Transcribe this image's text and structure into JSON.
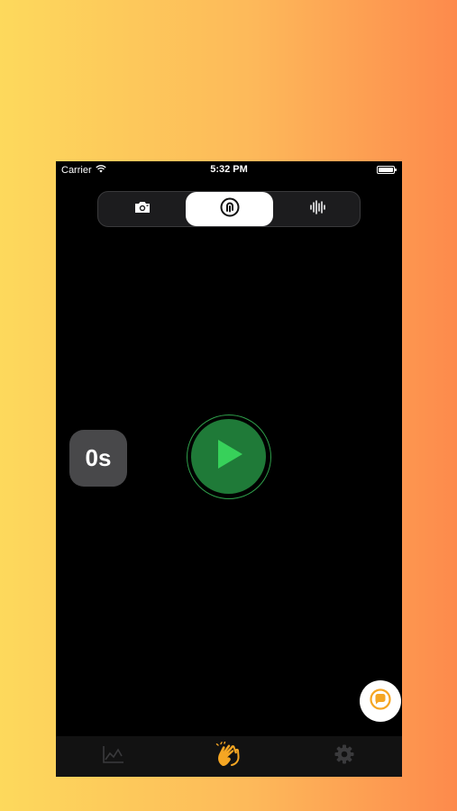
{
  "status_bar": {
    "carrier": "Carrier",
    "time": "5:32 PM"
  },
  "mode_switch": {
    "segments": [
      {
        "id": "camera",
        "icon": "camera-icon",
        "selected": false
      },
      {
        "id": "touch",
        "icon": "fingerprint-icon",
        "selected": true
      },
      {
        "id": "sound",
        "icon": "waveform-icon",
        "selected": false
      }
    ]
  },
  "timer": {
    "label": "0s"
  },
  "play_button": {
    "icon": "play-icon"
  },
  "feedback_button": {
    "icon": "chat-bubble-icon"
  },
  "tab_bar": {
    "items": [
      {
        "id": "stats",
        "icon": "chart-line-icon",
        "selected": false
      },
      {
        "id": "tap",
        "icon": "hands-clap-icon",
        "selected": true
      },
      {
        "id": "settings",
        "icon": "gear-icon",
        "selected": false
      }
    ]
  },
  "colors": {
    "background_gradient": [
      "#fdd95c",
      "#fd8a4c"
    ],
    "screen": "#000000",
    "play_green": "#1f7a38",
    "play_triangle": "#37d15a",
    "accent_orange": "#f5a623",
    "inactive_icon": "#3a3a3c"
  }
}
